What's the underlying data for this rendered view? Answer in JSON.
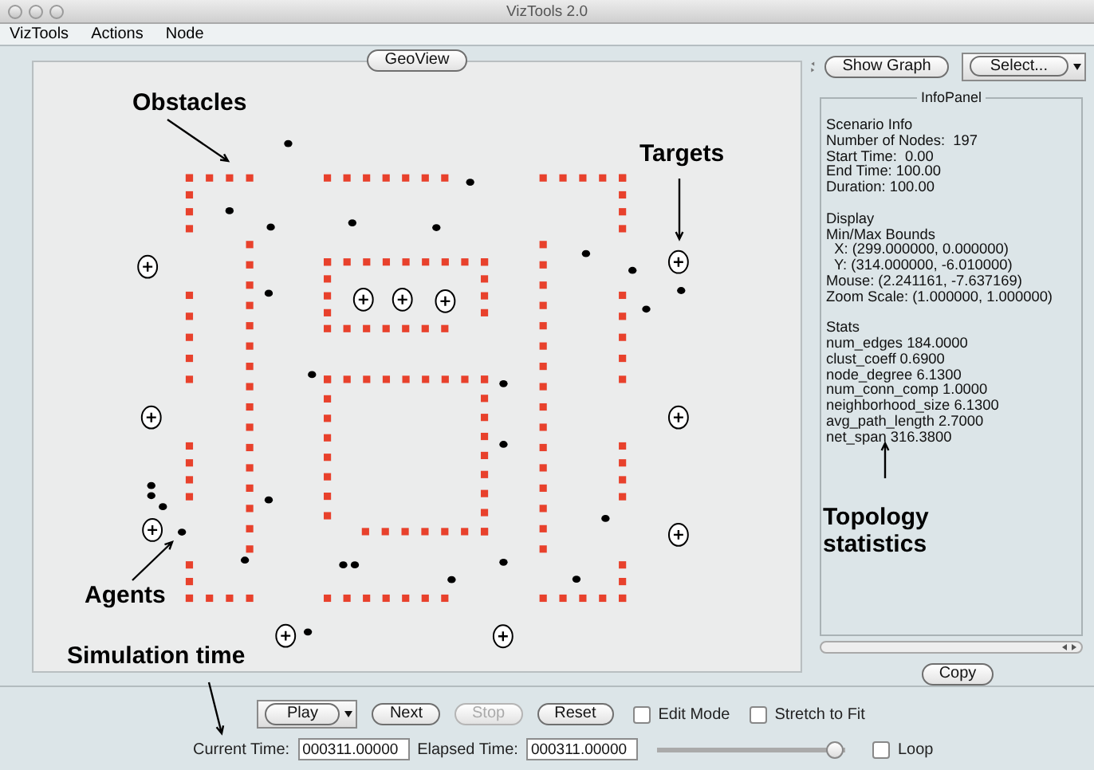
{
  "window": {
    "title": "VizTools 2.0"
  },
  "menu": [
    {
      "label": "VizTools"
    },
    {
      "label": "Actions"
    },
    {
      "label": "Node"
    }
  ],
  "geo_view": {
    "title": "GeoView"
  },
  "side": {
    "show_graph": "Show Graph",
    "select": "Select..."
  },
  "info_panel": {
    "title": "InfoPanel",
    "sections": [
      {
        "lines": [
          "Scenario Info",
          "Number of Nodes:  197",
          "Start Time:  0.00",
          "End Time: 100.00",
          "Duration: 100.00"
        ]
      },
      {
        "lines": [
          "Display",
          "Min/Max Bounds",
          "  X: (299.000000, 0.000000)",
          "  Y: (314.000000, -6.010000)",
          "Mouse: (2.241161, -7.637169)",
          "Zoom Scale: (1.000000, 1.000000)"
        ]
      },
      {
        "lines": [
          "Stats",
          "num_edges 184.0000",
          "clust_coeff 0.6900",
          "node_degree 6.1300",
          "num_conn_comp 1.0000",
          "neighborhood_size 6.1300",
          "avg_path_length 2.7000",
          "net_span 316.3800"
        ]
      }
    ]
  },
  "copy_button": "Copy",
  "controls": {
    "play": "Play",
    "buttons": [
      {
        "label": "Next",
        "disabled": false
      },
      {
        "label": "Stop",
        "disabled": true
      },
      {
        "label": "Reset",
        "disabled": false
      }
    ],
    "checkboxes": [
      {
        "label": "Edit Mode",
        "checked": false
      },
      {
        "label": "Stretch to Fit",
        "checked": false
      }
    ],
    "current_time": {
      "label": "Current Time:",
      "value": "000311.00000"
    },
    "elapsed_time": {
      "label": "Elapsed Time:",
      "value": "000311.00000"
    },
    "slider": {
      "level": 1.0
    },
    "loop": {
      "label": "Loop",
      "checked": false
    }
  },
  "annotations": [
    {
      "text": "Obstacles"
    },
    {
      "text": "Targets"
    },
    {
      "text": "Agents"
    },
    {
      "text": "Topology statistics"
    },
    {
      "text": "Simulation time"
    }
  ]
}
